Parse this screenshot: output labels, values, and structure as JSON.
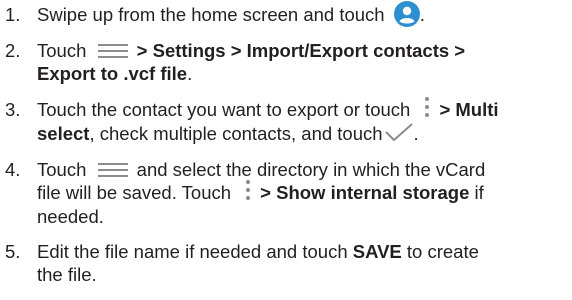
{
  "steps": [
    {
      "number": "1.",
      "lines": [
        {
          "a": "Swipe up from the home screen and touch",
          "icon": "contacts-icon",
          "b": "."
        }
      ]
    },
    {
      "number": "2.",
      "lines": [
        {
          "a": "Touch",
          "icon": "menu-icon",
          "bold": "> Settings > Import/Export contacts >"
        },
        {
          "bold": "Export to .vcf file",
          "b": "."
        }
      ]
    },
    {
      "number": "3.",
      "lines": [
        {
          "a": "Touch the contact you want to export or touch",
          "icon": "more-vert-icon",
          "bold": "> Multi"
        },
        {
          "bold": "select",
          "a": ", check multiple contacts, and touch",
          "icon": "check-icon",
          "b": "."
        }
      ]
    },
    {
      "number": "4.",
      "lines": [
        {
          "a": "Touch",
          "icon": "menu-icon",
          "b": "and select the directory in which the vCard"
        },
        {
          "a": "file will be saved. Touch",
          "icon": "more-vert-icon",
          "bold": "> Show internal storage",
          "b": " if"
        },
        {
          "a": "needed."
        }
      ]
    },
    {
      "number": "5.",
      "lines": [
        {
          "a": "Edit the file name if needed and touch",
          "bold": "SAVE",
          "b": "to create"
        },
        {
          "a": "the file."
        }
      ]
    }
  ],
  "colors": {
    "text": "#231f20",
    "icon_blue": "#2e8fd0",
    "icon_gray": "#8c8c8c"
  }
}
